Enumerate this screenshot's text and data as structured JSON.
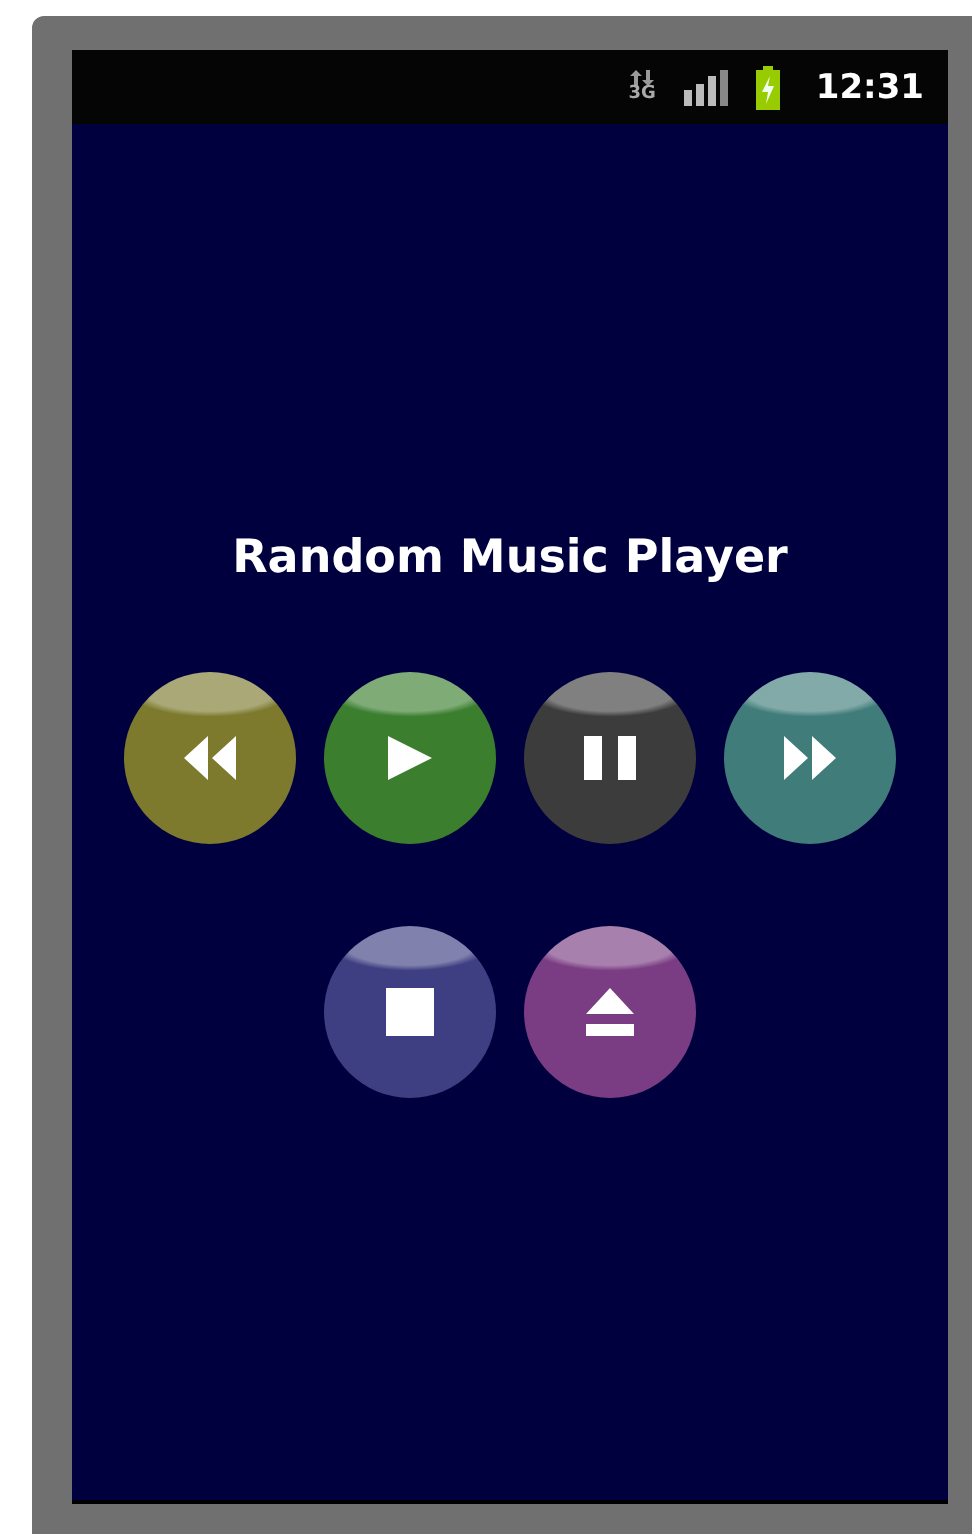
{
  "status_bar": {
    "network": "3G",
    "time": "12:31"
  },
  "title": "Random Music Player",
  "button_rows": [
    {
      "buttons": [
        {
          "kind": "rewind",
          "color": "#7d7a2e"
        },
        {
          "kind": "play",
          "color": "#3a7e2e"
        },
        {
          "kind": "pause",
          "color": "#3c3c3c"
        },
        {
          "kind": "forward",
          "color": "#3f7c7a"
        }
      ]
    },
    {
      "buttons": [
        {
          "kind": "stop",
          "color": "#3e3e82"
        },
        {
          "kind": "eject",
          "color": "#7a3c82"
        }
      ]
    }
  ]
}
